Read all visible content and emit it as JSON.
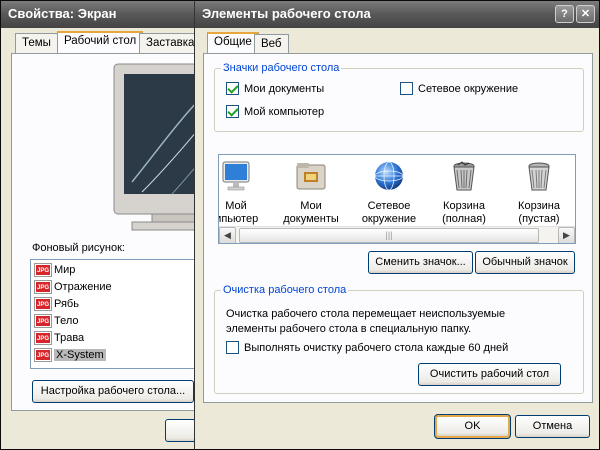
{
  "back_window": {
    "title": "Свойства: Экран",
    "tabs": [
      "Темы",
      "Рабочий стол",
      "Заставка"
    ],
    "background_label": "Фоновый рисунок:",
    "wallpapers": [
      "Мир",
      "Отражение",
      "Рябь",
      "Тело",
      "Трава",
      "X-System"
    ],
    "selected_wallpaper": "X-System",
    "file_badge": "JPG",
    "customize_button": "Настройка рабочего стола..."
  },
  "dialog": {
    "title": "Элементы рабочего стола",
    "help_glyph": "?",
    "close_glyph": "✕",
    "tabs": [
      "Общие",
      "Веб"
    ],
    "icons_group": {
      "legend": "Значки рабочего стола",
      "checkboxes": [
        {
          "label": "Мои документы",
          "checked": true
        },
        {
          "label": "Сетевое окружение",
          "checked": false
        },
        {
          "label": "Мой компьютер",
          "checked": true
        }
      ]
    },
    "icon_list": [
      {
        "line1": "Мой",
        "line2": "мпьютер",
        "icon": "monitor-icon"
      },
      {
        "line1": "Мои",
        "line2": "документы",
        "icon": "folder-icon"
      },
      {
        "line1": "Сетевое",
        "line2": "окружение",
        "icon": "network-globe-icon"
      },
      {
        "line1": "Корзина",
        "line2": "(полная)",
        "icon": "trash-full-icon"
      },
      {
        "line1": "Корзина",
        "line2": "(пустая)",
        "icon": "trash-empty-icon"
      }
    ],
    "change_icon_button": "Сменить значок...",
    "default_icon_button": "Обычный значок",
    "cleanup_group": {
      "legend": "Очистка рабочего стола",
      "description": "Очистка рабочего стола перемещает неиспользуемые элементы рабочего стола в специальную папку.",
      "checkbox": {
        "label": "Выполнять очистку рабочего стола каждые 60 дней",
        "checked": false
      },
      "button": "Очистить рабочий стол"
    },
    "ok_button": "OK",
    "cancel_button": "Отмена"
  }
}
